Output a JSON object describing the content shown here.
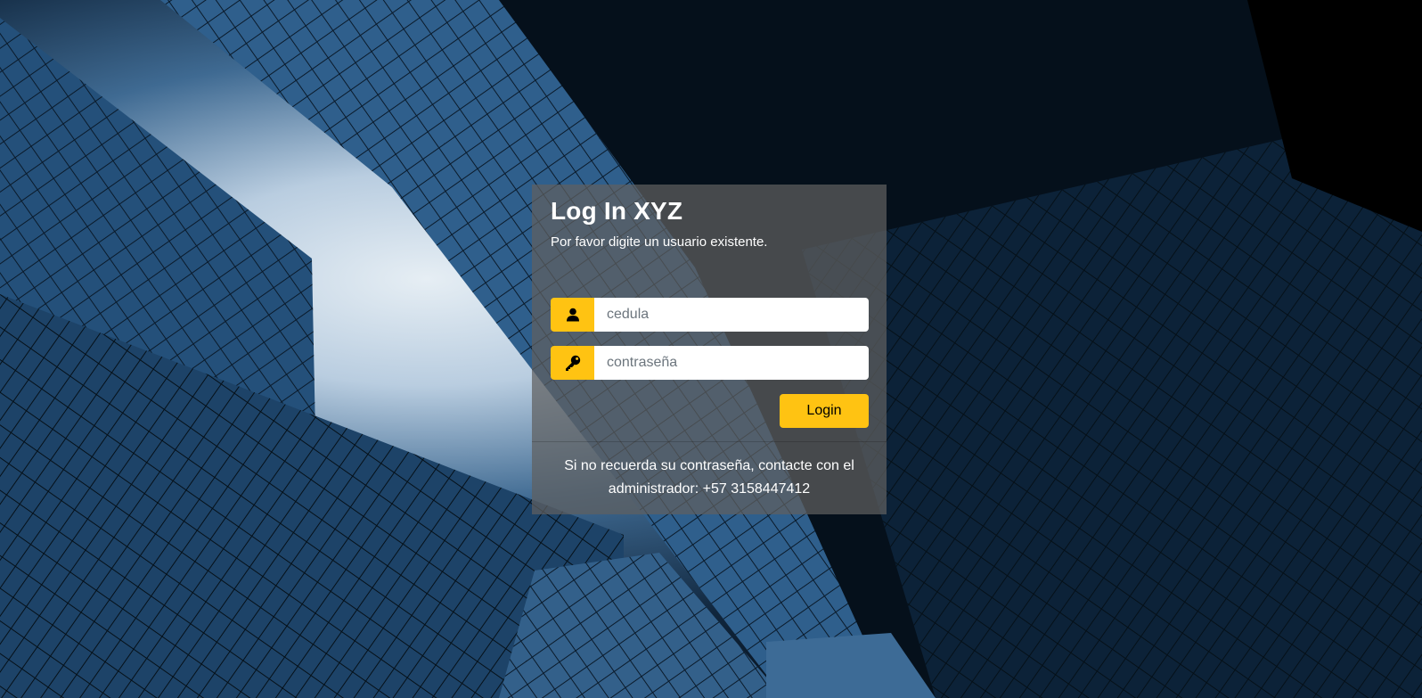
{
  "card": {
    "title": "Log In XYZ",
    "subtitle": "Por favor digite un usuario existente."
  },
  "form": {
    "user_icon": "user-icon",
    "user_placeholder": "cedula",
    "user_value": "",
    "password_icon": "key-icon",
    "password_placeholder": "contraseña",
    "password_value": "",
    "login_label": "Login"
  },
  "footer": {
    "line1": "Si no recuerda su contraseña, contacte con el",
    "line2": "administrador: +57 3158447412"
  },
  "colors": {
    "accent": "#ffc312",
    "card_bg": "rgba(95,95,95,0.72)",
    "text": "#ffffff"
  }
}
